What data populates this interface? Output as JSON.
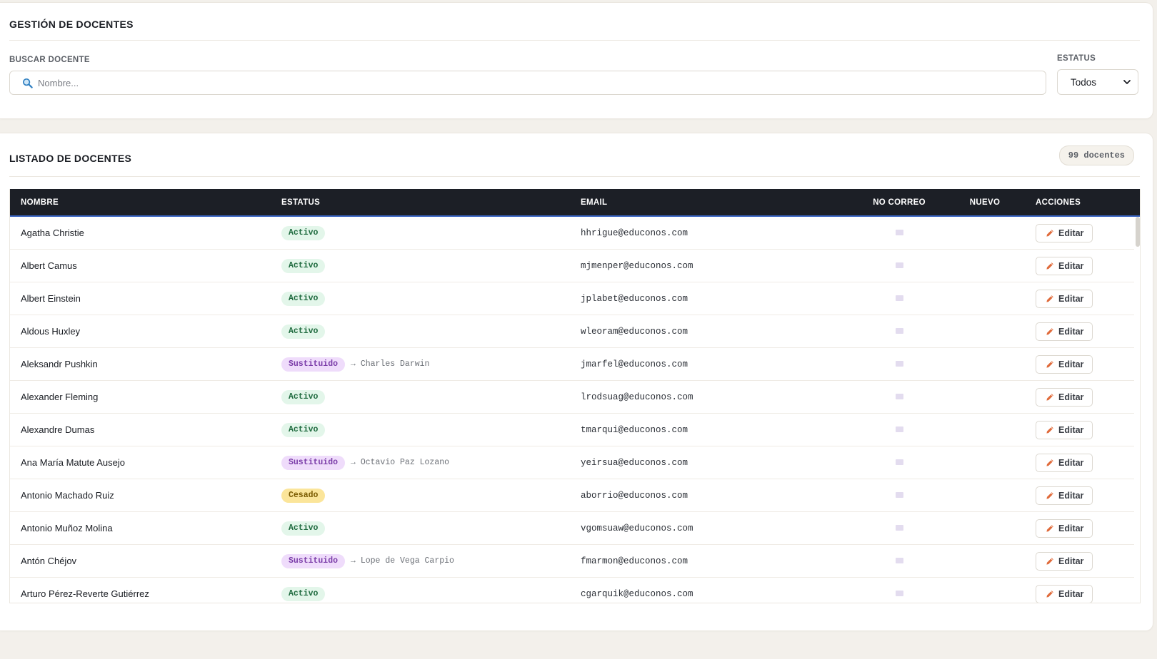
{
  "filters": {
    "title": "GESTIÓN DE DOCENTES",
    "search_label": "BUSCAR DOCENTE",
    "search_placeholder": "Nombre...",
    "search_value": "",
    "status_label": "ESTATUS",
    "status_selected": "Todos"
  },
  "list": {
    "title": "LISTADO DE DOCENTES",
    "count_label": "99 docentes",
    "columns": [
      "NOMBRE",
      "ESTATUS",
      "EMAIL",
      "NO CORREO",
      "NUEVO",
      "ACCIONES"
    ],
    "edit_label": "Editar",
    "rows": [
      {
        "name": "Agatha Christie",
        "status": "Activo",
        "replacement": "",
        "email": "hhrigue@educonos.com"
      },
      {
        "name": "Albert Camus",
        "status": "Activo",
        "replacement": "",
        "email": "mjmenper@educonos.com"
      },
      {
        "name": "Albert Einstein",
        "status": "Activo",
        "replacement": "",
        "email": "jplabet@educonos.com"
      },
      {
        "name": "Aldous Huxley",
        "status": "Activo",
        "replacement": "",
        "email": "wleoram@educonos.com"
      },
      {
        "name": "Aleksandr Pushkin",
        "status": "Sustituido",
        "replacement": "→ Charles Darwin",
        "email": "jmarfel@educonos.com"
      },
      {
        "name": "Alexander Fleming",
        "status": "Activo",
        "replacement": "",
        "email": "lrodsuag@educonos.com"
      },
      {
        "name": "Alexandre Dumas",
        "status": "Activo",
        "replacement": "",
        "email": "tmarqui@educonos.com"
      },
      {
        "name": "Ana María Matute Ausejo",
        "status": "Sustituido",
        "replacement": "→ Octavio Paz Lozano",
        "email": "yeirsua@educonos.com"
      },
      {
        "name": "Antonio Machado Ruiz",
        "status": "Cesado",
        "replacement": "",
        "email": "aborrio@educonos.com"
      },
      {
        "name": "Antonio Muñoz Molina",
        "status": "Activo",
        "replacement": "",
        "email": "vgomsuaw@educonos.com"
      },
      {
        "name": "Antón Chéjov",
        "status": "Sustituido",
        "replacement": "→ Lope de Vega Carpio",
        "email": "fmarmon@educonos.com"
      },
      {
        "name": "Arturo Pérez-Reverte Gutiérrez",
        "status": "Activo",
        "replacement": "",
        "email": "cgarquik@educonos.com"
      }
    ]
  },
  "colors": {
    "header_bg": "#1c1f26",
    "header_accent": "#3b66c4",
    "activo_bg": "#e3f6ea",
    "sustituido_bg": "#efdcfb",
    "cesado_bg": "#fbe59a",
    "edit_icon": "#e06a3a"
  },
  "icons": {
    "search": "search-icon",
    "chevron": "chevron-down-icon",
    "edit": "pencil-icon",
    "no_mail": "mail-icon"
  }
}
